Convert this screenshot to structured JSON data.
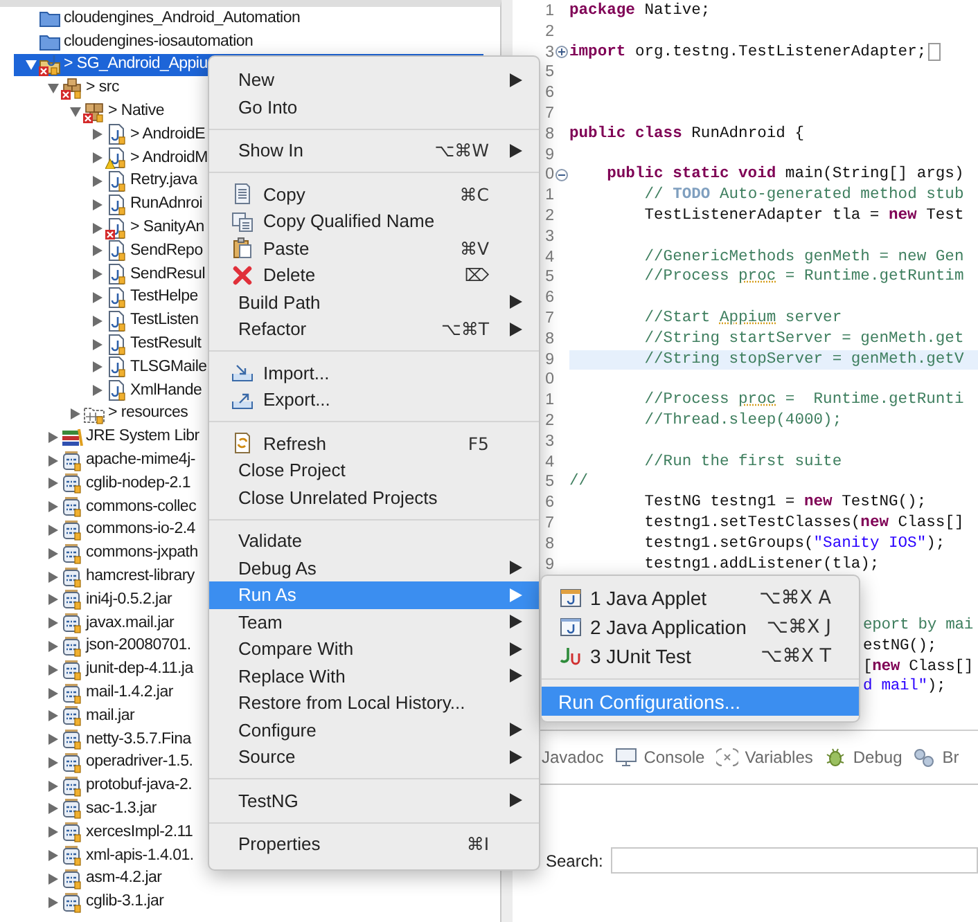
{
  "explorer": {
    "tree": [
      {
        "label": "cloudengines_Android_Automation",
        "kind": "project-folder",
        "selected": false
      },
      {
        "label": "cloudengines-iosautomation",
        "kind": "project-folder",
        "selected": false
      },
      {
        "label": "> SG_Android_Appiu",
        "kind": "project",
        "error": true,
        "expanded": true,
        "selected": true,
        "children": [
          {
            "label": "> src",
            "kind": "source-folder",
            "error": true,
            "expanded": true,
            "selected": false,
            "children": [
              {
                "label": "> Native",
                "kind": "package",
                "error": true,
                "expanded": true,
                "selected": false,
                "children": [
                  {
                    "label": "> AndroidE",
                    "kind": "java-file",
                    "expanded": false,
                    "selected": false
                  },
                  {
                    "label": "> AndroidM",
                    "kind": "java-file",
                    "warning": true,
                    "expanded": false,
                    "selected": false
                  },
                  {
                    "label": "Retry.java",
                    "kind": "java-file",
                    "expanded": false,
                    "selected": false
                  },
                  {
                    "label": "RunAdnroi",
                    "kind": "java-file",
                    "expanded": false,
                    "selected": false
                  },
                  {
                    "label": "> SanityAn",
                    "kind": "java-file",
                    "error": true,
                    "expanded": false,
                    "selected": false
                  },
                  {
                    "label": "SendRepo",
                    "kind": "java-file",
                    "expanded": false,
                    "selected": false
                  },
                  {
                    "label": "SendResul",
                    "kind": "java-file",
                    "expanded": false,
                    "selected": false
                  },
                  {
                    "label": "TestHelpe",
                    "kind": "java-file",
                    "expanded": false,
                    "selected": false
                  },
                  {
                    "label": "TestListen",
                    "kind": "java-file",
                    "expanded": false,
                    "selected": false
                  },
                  {
                    "label": "TestResult",
                    "kind": "java-file",
                    "expanded": false,
                    "selected": false
                  },
                  {
                    "label": "TLSGMaile",
                    "kind": "java-file",
                    "expanded": false,
                    "selected": false
                  },
                  {
                    "label": "XmlHande",
                    "kind": "java-file",
                    "expanded": false,
                    "selected": false
                  }
                ]
              },
              {
                "label": "> resources",
                "kind": "folder",
                "expanded": false,
                "selected": false
              }
            ]
          },
          {
            "label": "JRE System Libr",
            "kind": "library",
            "expanded": false,
            "selected": false
          },
          {
            "label": "apache-mime4j-",
            "kind": "jar",
            "expanded": false,
            "selected": false
          },
          {
            "label": "cglib-nodep-2.1",
            "kind": "jar",
            "expanded": false,
            "selected": false
          },
          {
            "label": "commons-collec",
            "kind": "jar",
            "expanded": false,
            "selected": false
          },
          {
            "label": "commons-io-2.4",
            "kind": "jar",
            "expanded": false,
            "selected": false
          },
          {
            "label": "commons-jxpath",
            "kind": "jar",
            "expanded": false,
            "selected": false
          },
          {
            "label": "hamcrest-library",
            "kind": "jar",
            "expanded": false,
            "selected": false
          },
          {
            "label": "ini4j-0.5.2.jar",
            "kind": "jar",
            "expanded": false,
            "selected": false
          },
          {
            "label": "javax.mail.jar",
            "kind": "jar",
            "expanded": false,
            "selected": false
          },
          {
            "label": "json-20080701.",
            "kind": "jar",
            "expanded": false,
            "selected": false
          },
          {
            "label": "junit-dep-4.11.ja",
            "kind": "jar",
            "expanded": false,
            "selected": false
          },
          {
            "label": "mail-1.4.2.jar",
            "kind": "jar",
            "expanded": false,
            "selected": false
          },
          {
            "label": "mail.jar",
            "kind": "jar",
            "expanded": false,
            "selected": false
          },
          {
            "label": "netty-3.5.7.Fina",
            "kind": "jar",
            "expanded": false,
            "selected": false
          },
          {
            "label": "operadriver-1.5.",
            "kind": "jar",
            "expanded": false,
            "selected": false
          },
          {
            "label": "protobuf-java-2.",
            "kind": "jar",
            "expanded": false,
            "selected": false
          },
          {
            "label": "sac-1.3.jar",
            "kind": "jar",
            "expanded": false,
            "selected": false
          },
          {
            "label": "xercesImpl-2.11",
            "kind": "jar",
            "expanded": false,
            "selected": false
          },
          {
            "label": "xml-apis-1.4.01.",
            "kind": "jar",
            "expanded": false,
            "selected": false
          },
          {
            "label": "asm-4.2.jar",
            "kind": "jar",
            "expanded": false,
            "selected": false
          },
          {
            "label": "cglib-3.1.jar",
            "kind": "jar",
            "expanded": false,
            "selected": false
          }
        ]
      }
    ]
  },
  "editor": {
    "lines": [
      {
        "kind": "code",
        "number": "1",
        "current": false,
        "tokens": [
          {
            "kind": "keyword",
            "text": "package"
          },
          {
            "kind": "plain",
            "text": " Native;"
          }
        ]
      },
      {
        "kind": "code",
        "number": "2",
        "current": false
      },
      {
        "kind": "fold-collapsed",
        "number": "3",
        "current": false,
        "tokens": [
          {
            "kind": "keyword",
            "text": "import"
          },
          {
            "kind": "plain",
            "text": " org.testng.TestListenerAdapter;"
          }
        ]
      },
      {
        "kind": "code",
        "number": "5",
        "current": false
      },
      {
        "kind": "code",
        "number": "6",
        "current": false
      },
      {
        "kind": "code",
        "number": "7",
        "current": false
      },
      {
        "kind": "code",
        "number": "8",
        "current": false,
        "tokens": [
          {
            "kind": "keyword",
            "text": "public class"
          },
          {
            "kind": "plain",
            "text": " RunAdnroid {"
          }
        ]
      },
      {
        "kind": "code",
        "number": "9",
        "current": false
      },
      {
        "kind": "fold-expanded",
        "number": "0",
        "current": false,
        "tokens": [
          {
            "kind": "keyword",
            "text": "    public static void"
          },
          {
            "kind": "plain",
            "text": " main(String[] args)"
          }
        ]
      },
      {
        "kind": "code",
        "number": "1",
        "current": false,
        "tokens": [
          {
            "kind": "comment",
            "text": "        // "
          },
          {
            "kind": "task",
            "text": "TODO"
          },
          {
            "kind": "comment",
            "text": " Auto-generated method stub"
          }
        ]
      },
      {
        "kind": "code",
        "number": "2",
        "current": false,
        "tokens": [
          {
            "kind": "plain",
            "text": "        TestListenerAdapter tla = "
          },
          {
            "kind": "keyword",
            "text": "new"
          },
          {
            "kind": "plain",
            "text": " Test"
          }
        ]
      },
      {
        "kind": "code",
        "number": "3",
        "current": false
      },
      {
        "kind": "code",
        "number": "4",
        "current": false,
        "tokens": [
          {
            "kind": "comment",
            "text": "        //GenericMethods genMeth = new Gen"
          }
        ]
      },
      {
        "kind": "code",
        "number": "5",
        "current": false,
        "tokens": [
          {
            "kind": "comment",
            "text": "        //Process "
          },
          {
            "kind": "typo",
            "text": "proc"
          },
          {
            "kind": "comment",
            "text": " = Runtime.getRuntim"
          }
        ]
      },
      {
        "kind": "code",
        "number": "6",
        "current": false
      },
      {
        "kind": "code",
        "number": "7",
        "current": false,
        "tokens": [
          {
            "kind": "comment",
            "text": "        //Start "
          },
          {
            "kind": "typo",
            "text": "Appium"
          },
          {
            "kind": "comment",
            "text": " server"
          }
        ]
      },
      {
        "kind": "code",
        "number": "8",
        "current": false,
        "tokens": [
          {
            "kind": "comment",
            "text": "        //String startServer = genMeth.get"
          }
        ]
      },
      {
        "kind": "code",
        "number": "9",
        "current": true,
        "tokens": [
          {
            "kind": "comment",
            "text": "        //String stopServer = genMeth.getV"
          }
        ]
      },
      {
        "kind": "code",
        "number": "0",
        "current": false
      },
      {
        "kind": "code",
        "number": "1",
        "current": false,
        "tokens": [
          {
            "kind": "comment",
            "text": "        //Process "
          },
          {
            "kind": "typo",
            "text": "proc"
          },
          {
            "kind": "comment",
            "text": " =  Runtime.getRunti"
          }
        ]
      },
      {
        "kind": "code",
        "number": "2",
        "current": false,
        "tokens": [
          {
            "kind": "comment",
            "text": "        //Thread.sleep(4000);"
          }
        ]
      },
      {
        "kind": "code",
        "number": "3",
        "current": false
      },
      {
        "kind": "code",
        "number": "4",
        "current": false,
        "tokens": [
          {
            "kind": "comment",
            "text": "        //Run the first suite"
          }
        ]
      },
      {
        "kind": "code",
        "number": "5",
        "current": false,
        "tokens": [
          {
            "kind": "comment",
            "text": "//"
          }
        ]
      },
      {
        "kind": "code",
        "number": "6",
        "current": false,
        "tokens": [
          {
            "kind": "plain",
            "text": "        TestNG testng1 = "
          },
          {
            "kind": "keyword",
            "text": "new"
          },
          {
            "kind": "plain",
            "text": " TestNG();"
          }
        ]
      },
      {
        "kind": "code",
        "number": "7",
        "current": false,
        "tokens": [
          {
            "kind": "plain",
            "text": "        testng1.setTestClasses("
          },
          {
            "kind": "keyword",
            "text": "new"
          },
          {
            "kind": "plain",
            "text": " Class[]"
          }
        ]
      },
      {
        "kind": "code",
        "number": "8",
        "current": false,
        "tokens": [
          {
            "kind": "plain",
            "text": "        testng1.setGroups("
          },
          {
            "kind": "string",
            "text": "\"Sanity IOS\""
          },
          {
            "kind": "plain",
            "text": ");"
          }
        ]
      },
      {
        "kind": "code",
        "number": "9",
        "current": false,
        "tokens": [
          {
            "kind": "plain",
            "text": "        testng1.addListener(tla);"
          }
        ]
      },
      {
        "kind": "hidden",
        "current": false
      },
      {
        "kind": "hidden",
        "current": false
      },
      {
        "kind": "partial",
        "current": false,
        "tokens": [
          {
            "kind": "comment",
            "text": "eport by mai"
          }
        ]
      },
      {
        "kind": "partial",
        "current": false,
        "tokens": [
          {
            "kind": "plain",
            "text": "estNG();"
          }
        ]
      },
      {
        "kind": "partial",
        "current": false,
        "tokens": [
          {
            "kind": "plain",
            "text": "["
          },
          {
            "kind": "keyword",
            "text": "new"
          },
          {
            "kind": "plain",
            "text": " Class[]"
          }
        ]
      },
      {
        "kind": "partial",
        "current": false,
        "tokens": [
          {
            "kind": "string",
            "text": "d mail\""
          },
          {
            "kind": "plain",
            "text": ");"
          }
        ]
      }
    ]
  },
  "bottom_panel": {
    "tabs": [
      {
        "label": "Javadoc",
        "kind": "plain"
      },
      {
        "label": "Console",
        "kind": "monitor"
      },
      {
        "label": "Variables",
        "kind": "variables"
      },
      {
        "label": "Debug",
        "kind": "bug"
      },
      {
        "label": "Br",
        "kind": "breakpoints"
      }
    ],
    "search": {
      "label": "Search:"
    }
  },
  "context_menu": {
    "groups": [
      [
        {
          "label": "New",
          "kind": "plain",
          "submenu": true,
          "selected": false
        },
        {
          "label": "Go Into",
          "kind": "plain",
          "submenu": false,
          "selected": false
        }
      ],
      [
        {
          "label": "Show In",
          "kind": "plain",
          "shortcut": "⌥⌘W",
          "submenu": true,
          "selected": false
        }
      ],
      [
        {
          "label": "Copy",
          "kind": "copy",
          "shortcut": "⌘C",
          "submenu": false,
          "selected": false
        },
        {
          "label": "Copy Qualified Name",
          "kind": "copy-name",
          "submenu": false,
          "selected": false
        },
        {
          "label": "Paste",
          "kind": "paste",
          "shortcut": "⌘V",
          "submenu": false,
          "selected": false
        },
        {
          "label": "Delete",
          "kind": "delete",
          "shortcut": "⌦",
          "submenu": false,
          "selected": false
        },
        {
          "label": "Build Path",
          "kind": "plain",
          "submenu": true,
          "selected": false
        },
        {
          "label": "Refactor",
          "kind": "plain",
          "shortcut": "⌥⌘T",
          "submenu": true,
          "selected": false
        }
      ],
      [
        {
          "label": "Import...",
          "kind": "import",
          "submenu": false,
          "selected": false
        },
        {
          "label": "Export...",
          "kind": "export",
          "submenu": false,
          "selected": false
        }
      ],
      [
        {
          "label": "Refresh",
          "kind": "refresh",
          "shortcut": "F5",
          "submenu": false,
          "selected": false
        },
        {
          "label": "Close Project",
          "kind": "plain",
          "submenu": false,
          "selected": false
        },
        {
          "label": "Close Unrelated Projects",
          "kind": "plain",
          "submenu": false,
          "selected": false
        }
      ],
      [
        {
          "label": "Validate",
          "kind": "plain",
          "submenu": false,
          "selected": false
        },
        {
          "label": "Debug As",
          "kind": "plain",
          "submenu": true,
          "selected": false
        },
        {
          "label": "Run As",
          "kind": "plain",
          "submenu": true,
          "selected": true
        },
        {
          "label": "Team",
          "kind": "plain",
          "submenu": true,
          "selected": false
        },
        {
          "label": "Compare With",
          "kind": "plain",
          "submenu": true,
          "selected": false
        },
        {
          "label": "Replace With",
          "kind": "plain",
          "submenu": true,
          "selected": false
        },
        {
          "label": "Restore from Local History...",
          "kind": "plain",
          "submenu": false,
          "selected": false
        },
        {
          "label": "Configure",
          "kind": "plain",
          "submenu": true,
          "selected": false
        },
        {
          "label": "Source",
          "kind": "plain",
          "submenu": true,
          "selected": false
        }
      ],
      [
        {
          "label": "TestNG",
          "kind": "plain",
          "submenu": true,
          "selected": false
        }
      ],
      [
        {
          "label": "Properties",
          "kind": "plain",
          "shortcut": "⌘I",
          "submenu": false,
          "selected": false
        }
      ]
    ]
  },
  "run_as_submenu": {
    "groups": [
      [
        {
          "label": "1 Java Applet",
          "kind": "applet",
          "shortcut": "⌥⌘X A",
          "selected": false
        },
        {
          "label": "2 Java Application",
          "kind": "application",
          "shortcut": "⌥⌘X J",
          "selected": false
        },
        {
          "label": "3 JUnit Test",
          "kind": "junit",
          "shortcut": "⌥⌘X T",
          "selected": false
        }
      ],
      [
        {
          "label": "Run Configurations...",
          "kind": "plain",
          "selected": true
        }
      ]
    ]
  }
}
